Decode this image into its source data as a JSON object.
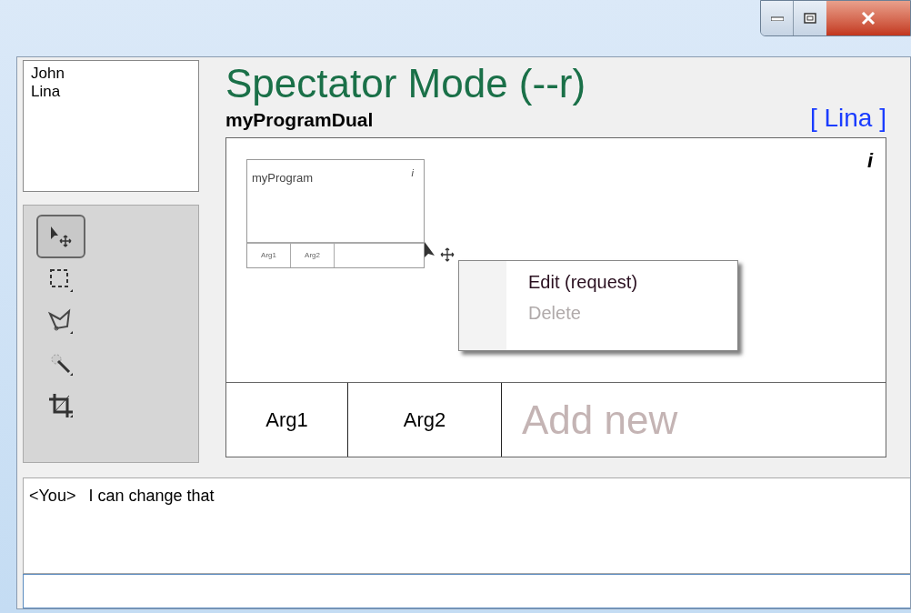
{
  "users": [
    "John",
    "Lina"
  ],
  "tools": [
    {
      "kind": "move",
      "selected": true
    },
    {
      "kind": "marquee",
      "selected": false
    },
    {
      "kind": "lasso",
      "selected": false
    },
    {
      "kind": "wand",
      "selected": false
    },
    {
      "kind": "crop",
      "selected": false
    }
  ],
  "title": "Spectator Mode (--r)",
  "program_name": "myProgramDual",
  "current_user": "[ Lina ]",
  "canvas": {
    "info": "i",
    "node": {
      "title": "myProgram",
      "info": "i",
      "args": [
        "Arg1",
        "Arg2"
      ]
    }
  },
  "args_row": [
    "Arg1",
    "Arg2"
  ],
  "add_new": "Add new",
  "context_menu": [
    {
      "label": "Edit (request)",
      "disabled": false
    },
    {
      "label": "Delete",
      "disabled": true
    }
  ],
  "chat": [
    {
      "sender": "<You>",
      "text": "I can change that"
    }
  ]
}
